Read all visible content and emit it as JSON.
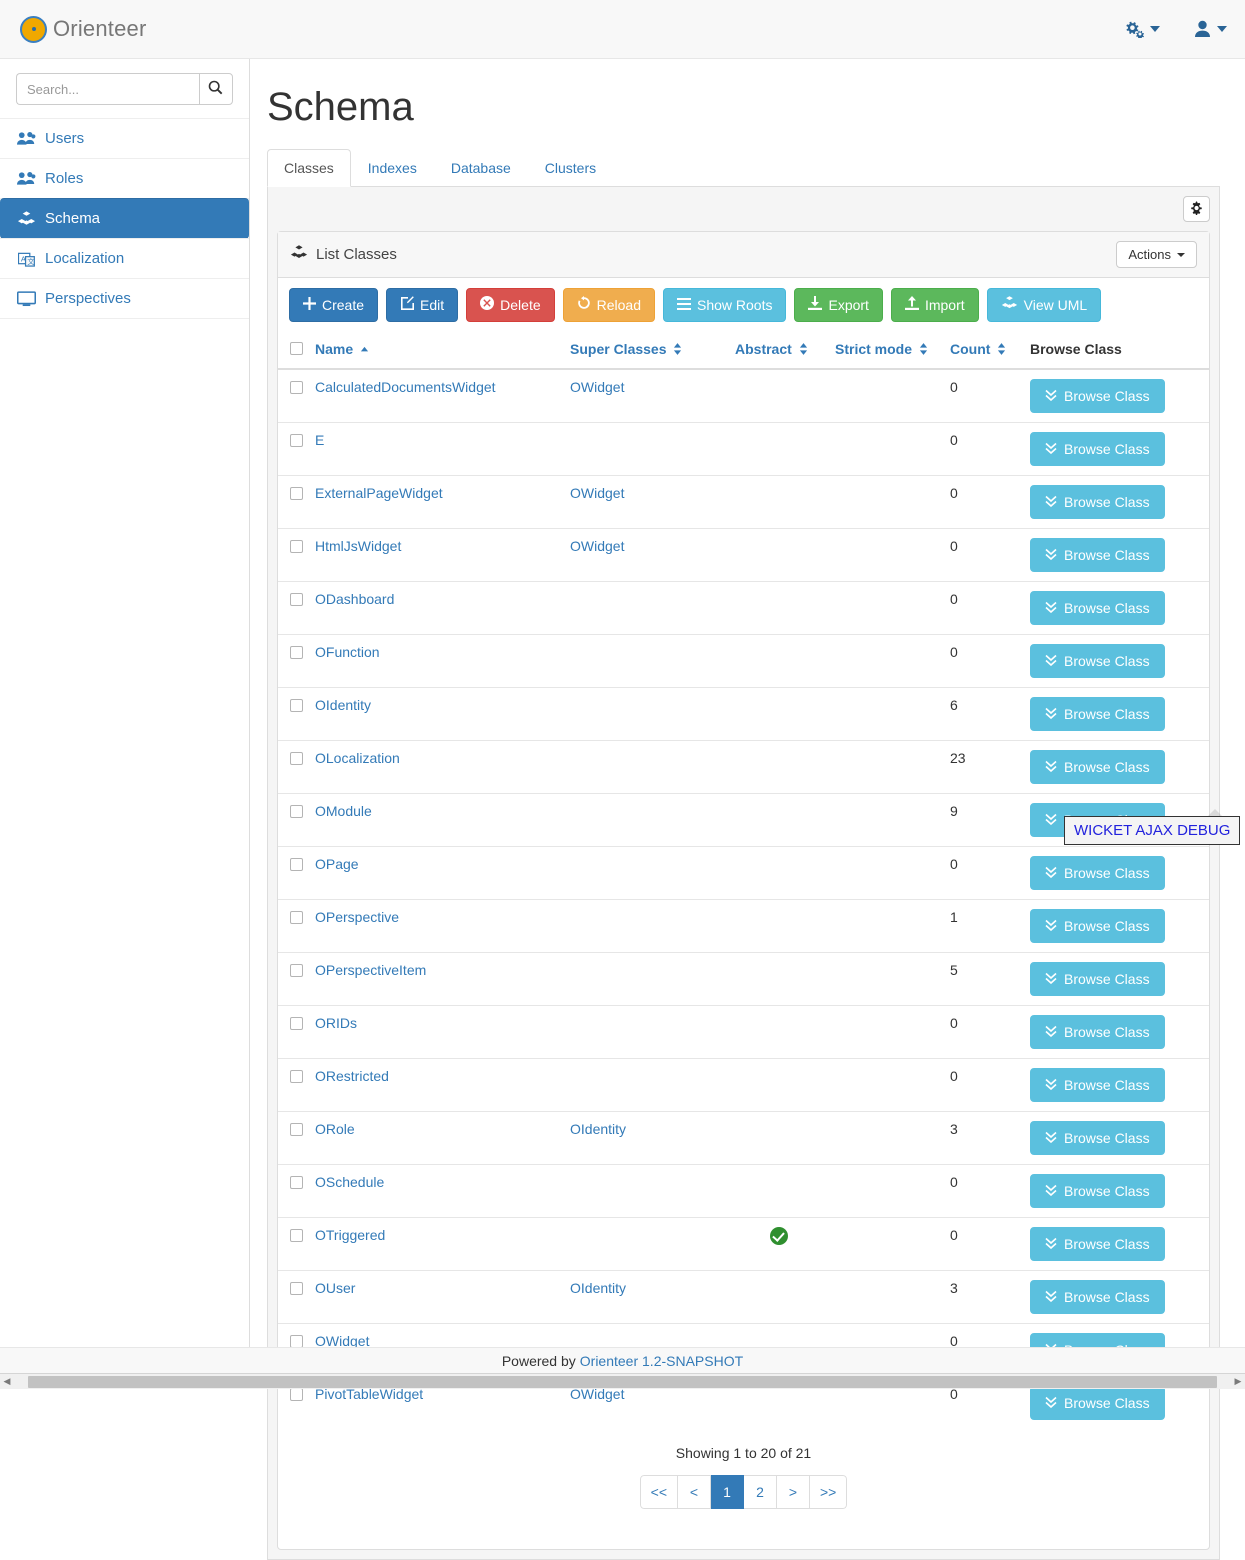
{
  "app": {
    "brand": "Orienteer",
    "logo_icon": "compass-icon",
    "footer_prefix": "Powered by",
    "footer_link": "Orienteer 1.2-SNAPSHOT"
  },
  "navbar": {
    "settings_icon": "cogs-icon",
    "user_icon": "user-icon"
  },
  "sidebar": {
    "search": {
      "placeholder": "Search...",
      "value": "",
      "icon": "search-icon"
    },
    "items": [
      {
        "label": "Users",
        "icon": "users-icon",
        "active": false
      },
      {
        "label": "Roles",
        "icon": "users-icon",
        "active": false
      },
      {
        "label": "Schema",
        "icon": "cubes-icon",
        "active": true
      },
      {
        "label": "Localization",
        "icon": "language-icon",
        "active": false
      },
      {
        "label": "Perspectives",
        "icon": "desktop-icon",
        "active": false
      }
    ]
  },
  "page": {
    "title": "Schema",
    "tabs": [
      {
        "label": "Classes",
        "active": true
      },
      {
        "label": "Indexes",
        "active": false
      },
      {
        "label": "Database",
        "active": false
      },
      {
        "label": "Clusters",
        "active": false
      }
    ],
    "gear_icon": "gear-icon"
  },
  "panel": {
    "title": "List Classes",
    "title_icon": "cubes-icon",
    "actions_label": "Actions",
    "toolbar": [
      {
        "label": "Create",
        "icon": "plus-icon",
        "style": "btn-primary"
      },
      {
        "label": "Edit",
        "icon": "pencil-icon",
        "style": "btn-primary"
      },
      {
        "label": "Delete",
        "icon": "times-icon",
        "style": "btn-danger"
      },
      {
        "label": "Reload",
        "icon": "refresh-icon",
        "style": "btn-warning"
      },
      {
        "label": "Show Roots",
        "icon": "bars-icon",
        "style": "btn-info"
      },
      {
        "label": "Export",
        "icon": "download-icon",
        "style": "btn-success"
      },
      {
        "label": "Import",
        "icon": "upload-icon",
        "style": "btn-success"
      },
      {
        "label": "View UML",
        "icon": "cubes-icon",
        "style": "btn-info"
      }
    ]
  },
  "table": {
    "columns": [
      {
        "label": "Name",
        "sortable": true,
        "sort": "asc",
        "link": true
      },
      {
        "label": "Super Classes",
        "sortable": true,
        "sort": "none",
        "link": true
      },
      {
        "label": "Abstract",
        "sortable": true,
        "sort": "none",
        "link": true
      },
      {
        "label": "Strict mode",
        "sortable": true,
        "sort": "none",
        "link": true
      },
      {
        "label": "Count",
        "sortable": true,
        "sort": "none",
        "link": true
      },
      {
        "label": "Browse Class",
        "sortable": false,
        "sort": "none",
        "link": false
      }
    ],
    "browse_label": "Browse Class",
    "browse_icon": "chevron-double-down-icon",
    "rows": [
      {
        "name": "CalculatedDocumentsWidget",
        "super": "OWidget",
        "abstract": false,
        "strict": "",
        "count": "0"
      },
      {
        "name": "E",
        "super": "",
        "abstract": false,
        "strict": "",
        "count": "0"
      },
      {
        "name": "ExternalPageWidget",
        "super": "OWidget",
        "abstract": false,
        "strict": "",
        "count": "0"
      },
      {
        "name": "HtmlJsWidget",
        "super": "OWidget",
        "abstract": false,
        "strict": "",
        "count": "0"
      },
      {
        "name": "ODashboard",
        "super": "",
        "abstract": false,
        "strict": "",
        "count": "0"
      },
      {
        "name": "OFunction",
        "super": "",
        "abstract": false,
        "strict": "",
        "count": "0"
      },
      {
        "name": "OIdentity",
        "super": "",
        "abstract": false,
        "strict": "",
        "count": "6"
      },
      {
        "name": "OLocalization",
        "super": "",
        "abstract": false,
        "strict": "",
        "count": "23"
      },
      {
        "name": "OModule",
        "super": "",
        "abstract": false,
        "strict": "",
        "count": "9"
      },
      {
        "name": "OPage",
        "super": "",
        "abstract": false,
        "strict": "",
        "count": "0"
      },
      {
        "name": "OPerspective",
        "super": "",
        "abstract": false,
        "strict": "",
        "count": "1"
      },
      {
        "name": "OPerspectiveItem",
        "super": "",
        "abstract": false,
        "strict": "",
        "count": "5"
      },
      {
        "name": "ORIDs",
        "super": "",
        "abstract": false,
        "strict": "",
        "count": "0"
      },
      {
        "name": "ORestricted",
        "super": "",
        "abstract": false,
        "strict": "",
        "count": "0"
      },
      {
        "name": "ORole",
        "super": "OIdentity",
        "abstract": false,
        "strict": "",
        "count": "3"
      },
      {
        "name": "OSchedule",
        "super": "",
        "abstract": false,
        "strict": "",
        "count": "0"
      },
      {
        "name": "OTriggered",
        "super": "",
        "abstract": true,
        "strict": "",
        "count": "0"
      },
      {
        "name": "OUser",
        "super": "OIdentity",
        "abstract": false,
        "strict": "",
        "count": "3"
      },
      {
        "name": "OWidget",
        "super": "",
        "abstract": false,
        "strict": "",
        "count": "0"
      },
      {
        "name": "PivotTableWidget",
        "super": "OWidget",
        "abstract": false,
        "strict": "",
        "count": "0"
      }
    ]
  },
  "pagination": {
    "showing": "Showing 1 to 20 of 21",
    "buttons": [
      {
        "label": "<<",
        "active": false
      },
      {
        "label": "<",
        "active": false
      },
      {
        "label": "1",
        "active": true
      },
      {
        "label": "2",
        "active": false
      },
      {
        "label": ">",
        "active": false
      },
      {
        "label": ">>",
        "active": false
      }
    ]
  },
  "overlays": {
    "wicket_debug": "WICKET AJAX DEBUG",
    "scroll_top_icon": "chevron-up-icon"
  },
  "colors": {
    "primary": "#337ab7",
    "danger": "#d9534f",
    "warning": "#f0ad4e",
    "info": "#5bc0de",
    "success": "#5cb85c",
    "brand_logo": "#f0a800",
    "abstract_check": "#2f8f2f",
    "debug_text": "#2222dd"
  }
}
